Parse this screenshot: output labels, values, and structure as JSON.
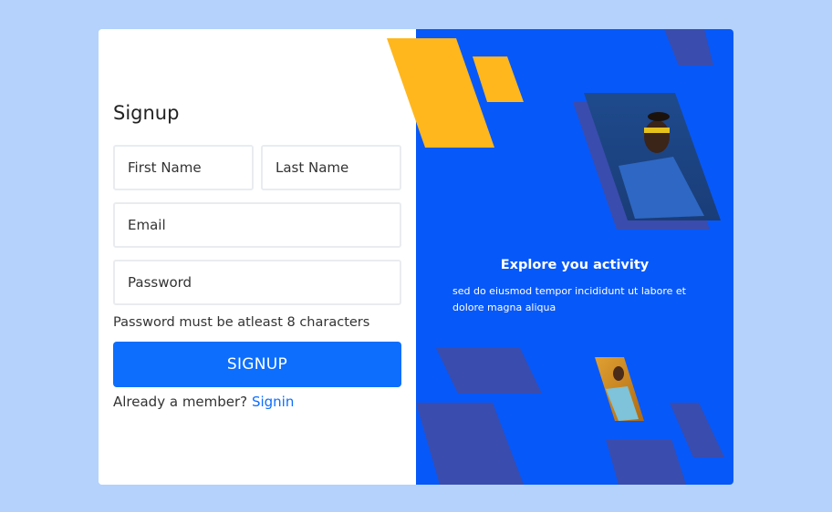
{
  "signup": {
    "title": "Signup",
    "first_name_placeholder": "First Name",
    "last_name_placeholder": "Last Name",
    "email_placeholder": "Email",
    "password_placeholder": "Password",
    "password_hint": "Password must be atleast 8 characters",
    "button_label": "SIGNUP",
    "member_text": "Already a member?",
    "signin_link": "Signin"
  },
  "promo": {
    "title": "Explore you activity",
    "text": "sed do eiusmod tempor incididunt ut labore et dolore magna aliqua"
  },
  "colors": {
    "page_bg": "#b4d2fb",
    "panel_blue": "#0758f8",
    "button_blue": "#0d6efd",
    "shape_yellow": "#ffb71d",
    "shape_indigo": "#3a4cad"
  }
}
